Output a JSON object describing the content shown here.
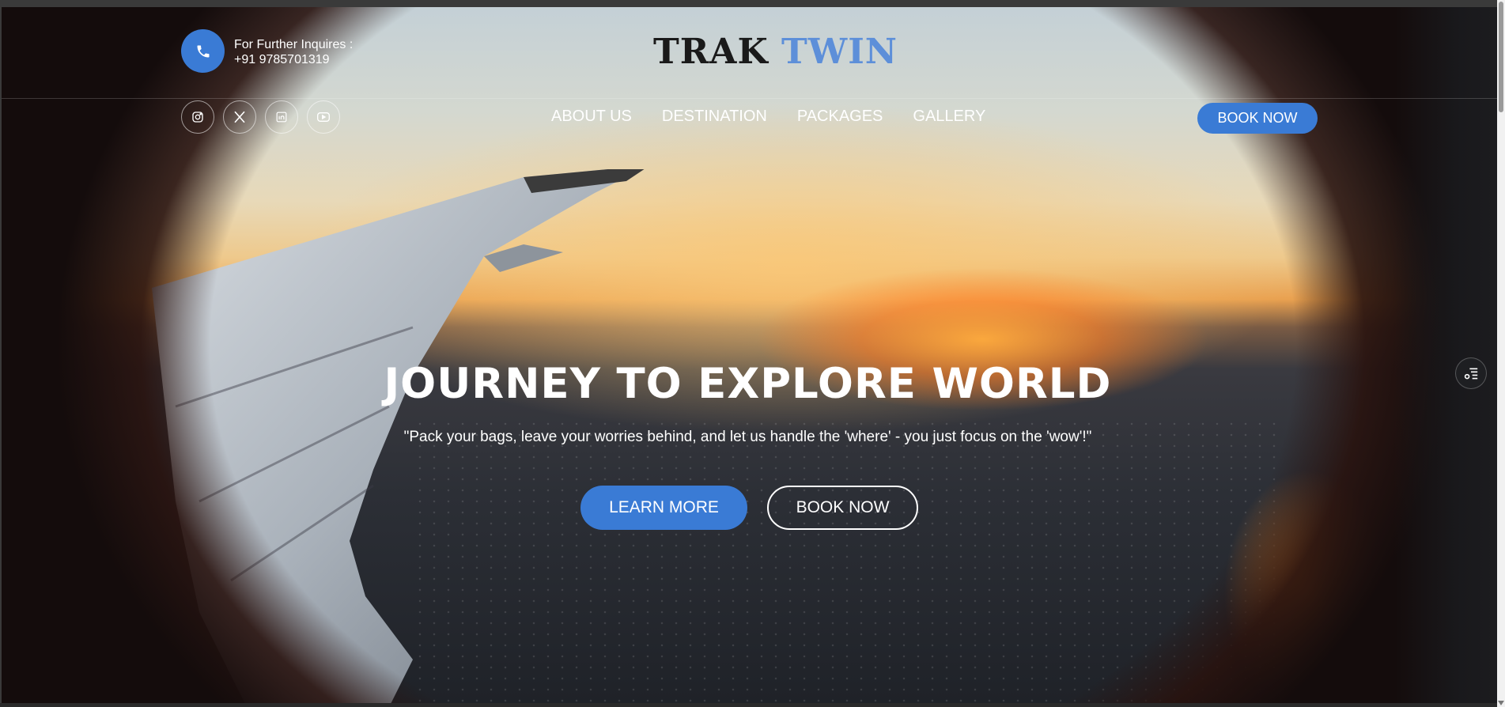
{
  "header": {
    "contact_label": "For Further Inquires :",
    "contact_phone": "+91 9785701319",
    "logo_part1": "TRAK",
    "logo_part2": "TWIN",
    "book_now": "BOOK NOW"
  },
  "socials": [
    {
      "icon": "instagram-icon"
    },
    {
      "icon": "x-twitter-icon"
    },
    {
      "icon": "linkedin-icon"
    },
    {
      "icon": "youtube-icon"
    }
  ],
  "nav": {
    "items": [
      "ABOUT US",
      "DESTINATION",
      "PACKAGES",
      "GALLERY"
    ]
  },
  "hero": {
    "title": "JOURNEY TO EXPLORE WORLD",
    "subtitle": "\"Pack your bags, leave your worries behind, and let us handle the 'where' - you just focus on the 'wow'!\"",
    "learn_more": "LEARN MORE",
    "book_now": "BOOK NOW"
  },
  "colors": {
    "accent": "#3a7bd5",
    "logo_accent": "#5d8fd9"
  }
}
